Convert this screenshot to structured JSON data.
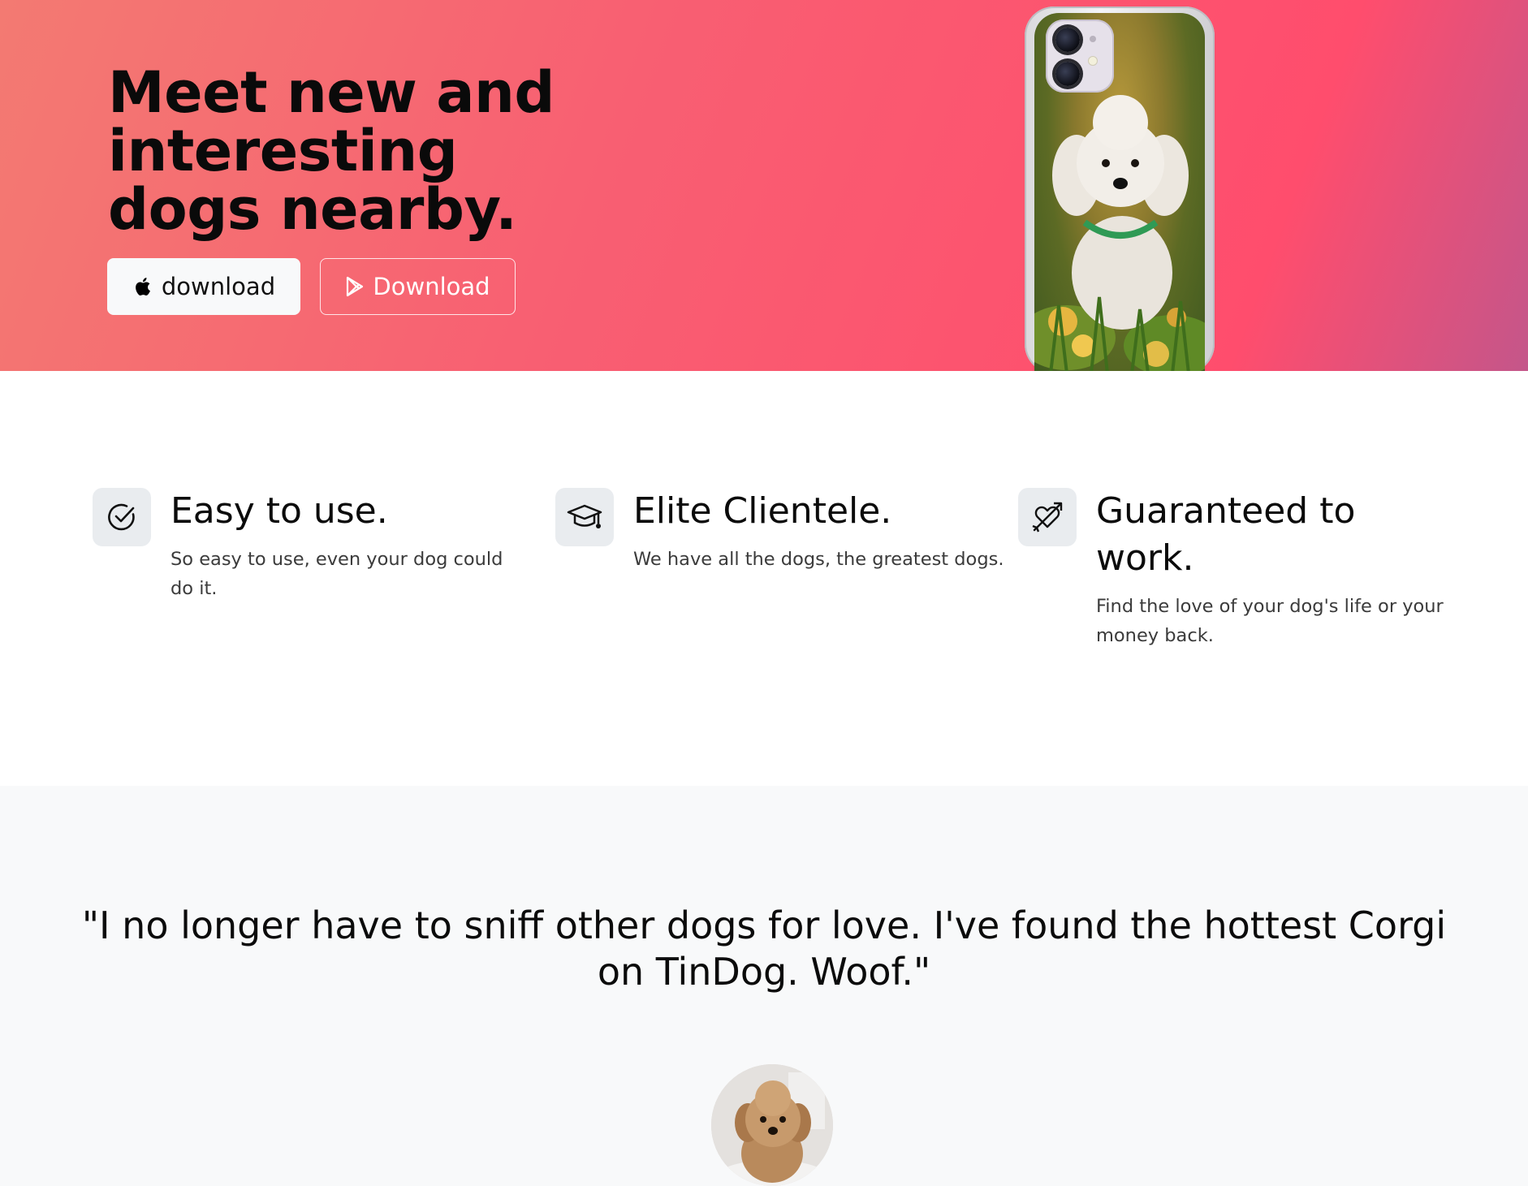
{
  "hero": {
    "title": "Meet new and interesting dogs nearby.",
    "apple_button_label": "download",
    "google_button_label": "Download",
    "gradient_colors": [
      "#f37a72",
      "#ff4d6d",
      "#c4568a"
    ]
  },
  "features": [
    {
      "icon": "check-circle-icon",
      "title": "Easy to use.",
      "text": "So easy to use, even your dog could do it."
    },
    {
      "icon": "mortarboard-icon",
      "title": "Elite Clientele.",
      "text": "We have all the dogs, the greatest dogs."
    },
    {
      "icon": "heart-arrow-icon",
      "title": "Guaranteed to work.",
      "text": "Find the love of your dog's life or your money back."
    }
  ],
  "testimonial": {
    "quote": "\"I no longer have to sniff other dogs for love. I've found the hottest Corgi on TinDog. Woof.\""
  }
}
